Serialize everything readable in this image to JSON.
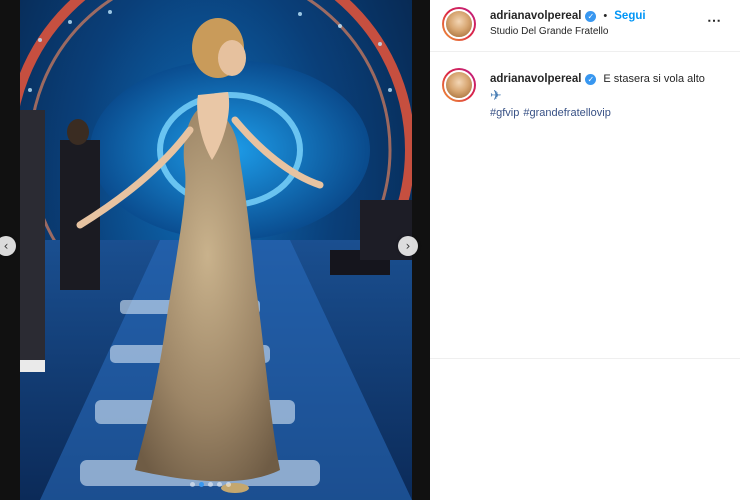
{
  "post": {
    "username": "adrianavolpereal",
    "verified": true,
    "separator": "•",
    "follow_label": "Segui",
    "location": "Studio Del Grande Fratello",
    "more_icon": "⋯"
  },
  "caption": {
    "username": "adrianavolpereal",
    "text": "E stasera si vola alto",
    "emoji_icon": "airplane-icon",
    "emoji_glyph": "✈",
    "hashtags": [
      "#gfvip",
      "#grandefratellovip"
    ]
  },
  "carousel": {
    "prev_glyph": "‹",
    "next_glyph": "›",
    "dot_count": 5,
    "active_index": 1
  },
  "colors": {
    "follow": "#0095f6",
    "verified": "#3897f0",
    "hashtag": "#385185",
    "stage_blue": "#0a3f79",
    "arch_red": "#e8553a"
  }
}
